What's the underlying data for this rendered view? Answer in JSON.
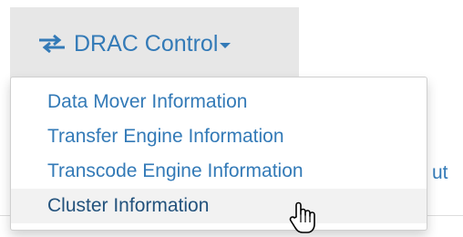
{
  "navbar": {
    "drac_control_label": "DRAC Control",
    "drac_icon": "swap-arrows-icon"
  },
  "dropdown": {
    "items": [
      {
        "label": "Data Mover Information"
      },
      {
        "label": "Transfer Engine Information"
      },
      {
        "label": "Transcode Engine Information"
      },
      {
        "label": "Cluster Information"
      }
    ],
    "hovered_index": 3
  },
  "background": {
    "partial_link_text": "ut"
  },
  "colors": {
    "link": "#337ab7",
    "toggle_bg": "#e7e7e7",
    "hover_bg": "#f2f2f2"
  },
  "cursor_icon": "hand-pointer-icon"
}
